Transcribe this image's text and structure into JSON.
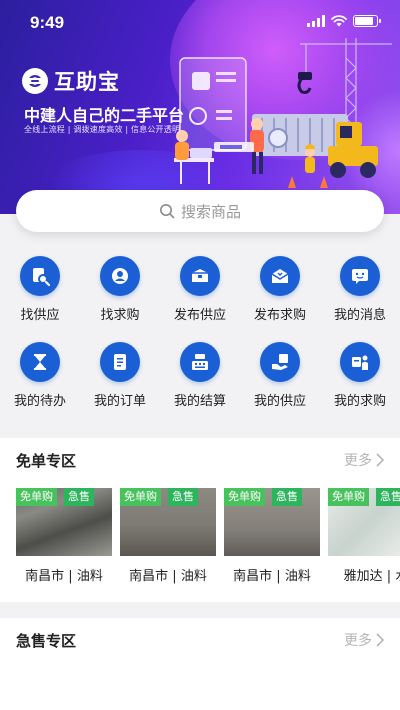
{
  "status_bar": {
    "time": "9:49"
  },
  "banner": {
    "logo_name": "互助宝",
    "tagline": "中建人自己的二手平台",
    "subtagline": "全线上流程 | 调拨速度高效 | 信息公开透明"
  },
  "search": {
    "placeholder": "搜索商品"
  },
  "grid": [
    {
      "label": "找供应",
      "icon": "search-icon"
    },
    {
      "label": "找求购",
      "icon": "user-search-icon"
    },
    {
      "label": "发布供应",
      "icon": "box-icon"
    },
    {
      "label": "发布求购",
      "icon": "mail-icon"
    },
    {
      "label": "我的消息",
      "icon": "chat-icon"
    },
    {
      "label": "我的待办",
      "icon": "hourglass-icon"
    },
    {
      "label": "我的订单",
      "icon": "document-icon"
    },
    {
      "label": "我的结算",
      "icon": "cash-register-icon"
    },
    {
      "label": "我的供应",
      "icon": "handshake-icon"
    },
    {
      "label": "我的求购",
      "icon": "cart-person-icon"
    }
  ],
  "sections": {
    "free": {
      "title": "免单专区",
      "more": "更多",
      "items": [
        {
          "label": "南昌市 | 油料",
          "tag_free": "免单购",
          "tag_urgent": "急售"
        },
        {
          "label": "南昌市 | 油料",
          "tag_free": "免单购",
          "tag_urgent": "急售"
        },
        {
          "label": "南昌市 | 油料",
          "tag_free": "免单购",
          "tag_urgent": "急售"
        },
        {
          "label": "雅加达 | 水",
          "tag_free": "免单购",
          "tag_urgent": "急售"
        }
      ]
    },
    "urgent": {
      "title": "急售专区",
      "more": "更多"
    }
  },
  "colors": {
    "primary": "#1a5fd3",
    "tag_green": "#48c25c",
    "banner": "#4a1fc8"
  }
}
